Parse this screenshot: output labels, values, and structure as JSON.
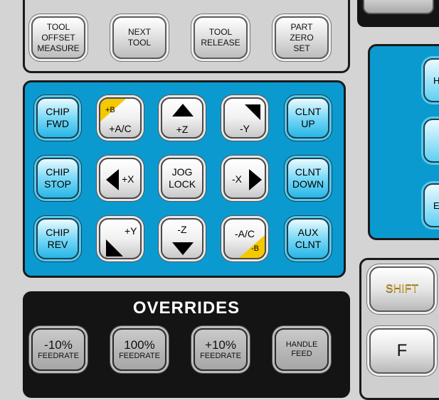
{
  "tool_buttons": {
    "offset_measure": [
      "TOOL",
      "OFFSET",
      "MEASURE"
    ],
    "next_tool": [
      "NEXT",
      "TOOL"
    ],
    "tool_release": [
      "TOOL",
      "RELEASE"
    ],
    "part_zero_set": [
      "PART",
      "ZERO",
      "SET"
    ]
  },
  "jog": {
    "chip_fwd": [
      "CHIP",
      "FWD"
    ],
    "plus_b": "+B",
    "plus_ac": "+A/C",
    "plus_z": "+Z",
    "minus_y": "-Y",
    "clnt_up": [
      "CLNT",
      "UP"
    ],
    "chip_stop": [
      "CHIP",
      "STOP"
    ],
    "plus_x": "+X",
    "jog_lock": [
      "JOG",
      "LOCK"
    ],
    "minus_x": "-X",
    "clnt_down": [
      "CLNT",
      "DOWN"
    ],
    "chip_rev": [
      "CHIP",
      "REV"
    ],
    "plus_y": "+Y",
    "minus_z": "-Z",
    "minus_ac": "-A/C",
    "minus_b": "-B",
    "aux_clnt": [
      "AUX",
      "CLNT"
    ]
  },
  "overrides": {
    "title": "OVERRIDES",
    "minus10": {
      "value": "-10%",
      "sub": "FEEDRATE"
    },
    "hundred": {
      "value": "100%",
      "sub": "FEEDRATE"
    },
    "plus10": {
      "value": "+10%",
      "sub": "FEEDRATE"
    },
    "handle": [
      "HANDLE",
      "FEED"
    ]
  },
  "right": {
    "partial_top": "H",
    "partial_bottom": "E",
    "shift": "SHIFT",
    "f_key": "F"
  },
  "colors": {
    "panel_blue": "#0b9ad0",
    "key_cyan": "#27b6e6",
    "accent_yellow": "#f5c800",
    "shift_text": "#c9a23a"
  }
}
